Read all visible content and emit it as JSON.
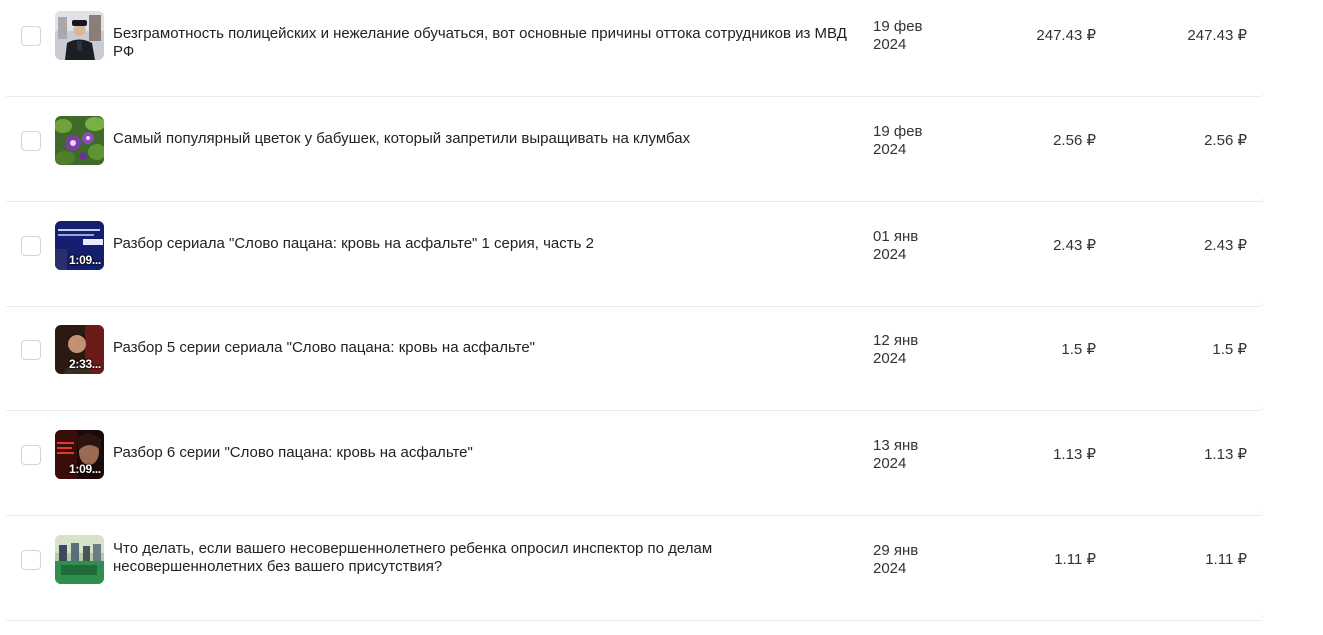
{
  "rows": [
    {
      "title": "Безграмотность полицейских и нежелание обучаться, вот основные причины оттока сотрудников из МВД РФ",
      "date_day": "19 фев",
      "date_year": "2024",
      "value1": "247.43 ₽",
      "value2": "247.43 ₽",
      "duration": ""
    },
    {
      "title": "Самый популярный цветок у бабушек, который запретили выращивать на клумбах",
      "date_day": "19 фев",
      "date_year": "2024",
      "value1": "2.56 ₽",
      "value2": "2.56 ₽",
      "duration": ""
    },
    {
      "title": "Разбор сериала \"Слово пацана: кровь на асфальте\" 1 серия, часть 2",
      "date_day": "01 янв",
      "date_year": "2024",
      "value1": "2.43 ₽",
      "value2": "2.43 ₽",
      "duration": "1:09..."
    },
    {
      "title": "Разбор 5 серии сериала \"Слово пацана: кровь на асфальте\"",
      "date_day": "12 янв",
      "date_year": "2024",
      "value1": "1.5 ₽",
      "value2": "1.5 ₽",
      "duration": "2:33..."
    },
    {
      "title": "Разбор 6 серии \"Слово пацана: кровь на асфальте\"",
      "date_day": "13 янв",
      "date_year": "2024",
      "value1": "1.13 ₽",
      "value2": "1.13 ₽",
      "duration": "1:09..."
    },
    {
      "title": "Что делать, если вашего несовершеннолетнего ребенка опросил инспектор по делам несовершеннолетних без вашего присутствия?",
      "date_day": "29 янв",
      "date_year": "2024",
      "value1": "1.11 ₽",
      "value2": "1.11 ₽",
      "duration": ""
    }
  ]
}
